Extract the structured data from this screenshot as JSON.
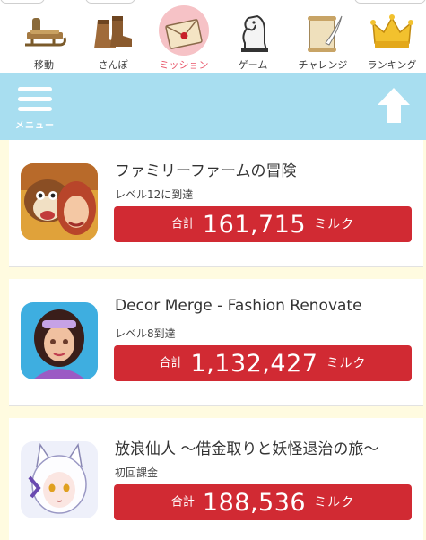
{
  "nav": {
    "items": [
      {
        "label": "移動",
        "icon": "sled-icon"
      },
      {
        "label": "さんぽ",
        "icon": "boots-icon"
      },
      {
        "label": "ミッション",
        "icon": "envelope-icon",
        "active": true
      },
      {
        "label": "ゲーム",
        "icon": "chess-knight-icon"
      },
      {
        "label": "チャレンジ",
        "icon": "scroll-quill-icon"
      },
      {
        "label": "ランキング",
        "icon": "crown-icon"
      }
    ],
    "active_color": "#e8566a"
  },
  "header": {
    "menu_label": "メニュー",
    "bar_color": "#a8def0"
  },
  "missions": [
    {
      "title": "ファミリーファームの冒険",
      "condition": "レベル12に到達",
      "total_label": "合計",
      "amount": "161,715",
      "unit": "ミルク",
      "thumb": "family-farm-app-icon"
    },
    {
      "title": "Decor Merge - Fashion Renovate",
      "condition": "レベル8到達",
      "total_label": "合計",
      "amount": "1,132,427",
      "unit": "ミルク",
      "thumb": "decor-merge-app-icon"
    },
    {
      "title": "放浪仙人 〜借金取りと妖怪退治の旅〜",
      "condition": "初回課金",
      "total_label": "合計",
      "amount": "188,536",
      "unit": "ミルク",
      "thumb": "hourou-sennin-app-icon"
    }
  ],
  "reward_color": "#d12a33"
}
